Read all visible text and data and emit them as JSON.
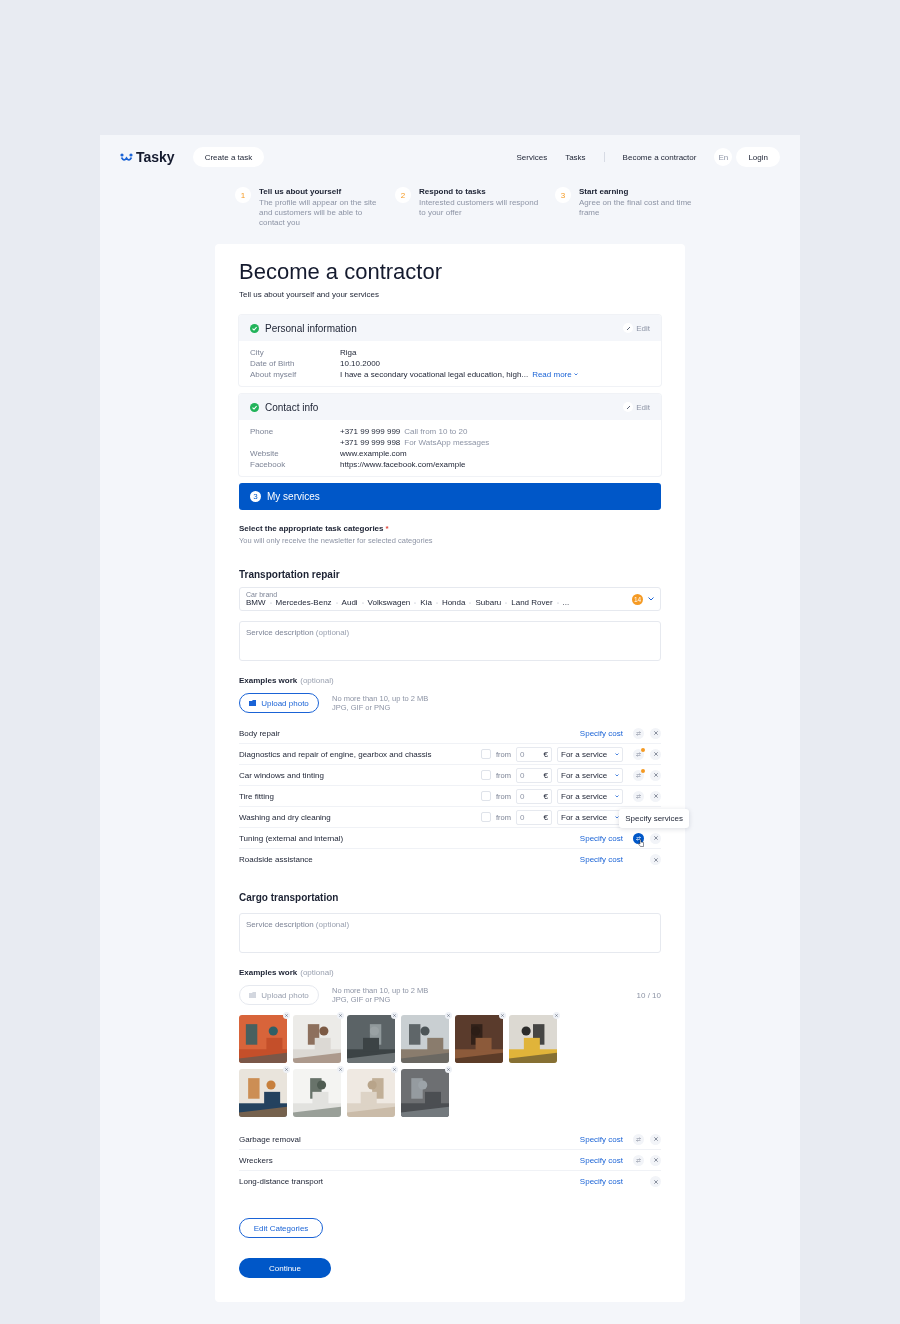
{
  "header": {
    "logo": "Tasky",
    "create_button": "Create a task",
    "nav": [
      "Services",
      "Tasks"
    ],
    "contractor_link": "Become a contractor",
    "language": "En",
    "login": "Login"
  },
  "steps": [
    {
      "number": "1",
      "title": "Tell us about yourself",
      "text": "The profile will appear on the site and customers will be able to contact you"
    },
    {
      "number": "2",
      "title": "Respond to tasks",
      "text": "Interested customers will respond to your offer"
    },
    {
      "number": "3",
      "title": "Start earning",
      "text": "Agree on the final cost and time frame"
    }
  ],
  "page": {
    "title": "Become a contractor",
    "subtitle": "Tell us about yourself and your services"
  },
  "sections": [
    {
      "kind": "completed",
      "title": "Personal information",
      "edit": "Edit",
      "rows": [
        {
          "label": "City",
          "value": "Riga"
        },
        {
          "label": "Date of Birth",
          "value": "10.10.2000"
        },
        {
          "label": "About myself",
          "value": "I have a secondary vocational legal education, high...",
          "link": "Read more"
        }
      ]
    },
    {
      "kind": "completed",
      "title": "Contact info",
      "edit": "Edit",
      "rows": [
        {
          "label": "Phone",
          "value": "+371 99 999 999",
          "note": "Call from 10 to 20"
        },
        {
          "value": "+371 99 999 998",
          "note": "For WatsApp messages"
        },
        {
          "label": "Website",
          "value": "www.example.com"
        },
        {
          "label": "Facebook",
          "value": "https://www.facebook.com/example"
        }
      ]
    },
    {
      "kind": "current",
      "number": "3",
      "title": "My services"
    }
  ],
  "categories": {
    "label": "Select the appropriate task categories",
    "required_mark": "*",
    "hint": "You will only receive the newsletter for selected categories"
  },
  "groups": [
    {
      "title": "Transportation repair",
      "brand_field": {
        "label": "Car brand",
        "values": [
          "BMW",
          "Mercedes-Benz",
          "Audi",
          "Volkswagen",
          "Kia",
          "Honda",
          "Subaru",
          "Land Rover",
          "..."
        ],
        "count": "14"
      },
      "description": {
        "placeholder": "Service description",
        "optional": "(optional)"
      },
      "examples": {
        "label": "Examples work",
        "optional": "(optional)",
        "upload": "Upload photo",
        "upload_disabled": false,
        "rules": [
          "No more than 10, up to 2 MB",
          "JPG, GIF or PNG"
        ]
      },
      "services": [
        {
          "name": "Body repair",
          "kind": "cost",
          "link": "Specify cost",
          "swap": true,
          "swap_badge": false,
          "swap_active": false,
          "removable": true
        },
        {
          "name": "Diagnostics and repair of engine, gearbox and chassis",
          "kind": "price",
          "checked": false,
          "from": "from",
          "amount": "0",
          "currency": "€",
          "unit": "For a service",
          "swap": true,
          "swap_badge": true,
          "swap_active": false,
          "removable": true
        },
        {
          "name": "Car windows and tinting",
          "kind": "price",
          "checked": false,
          "from": "from",
          "amount": "0",
          "currency": "€",
          "unit": "For a service",
          "swap": true,
          "swap_badge": true,
          "swap_active": false,
          "removable": true
        },
        {
          "name": "Tire fitting",
          "kind": "price",
          "checked": false,
          "from": "from",
          "amount": "0",
          "currency": "€",
          "unit": "For a service",
          "swap": true,
          "swap_badge": false,
          "swap_active": false,
          "removable": true
        },
        {
          "name": "Washing and dry cleaning",
          "kind": "price",
          "checked": false,
          "from": "from",
          "amount": "0",
          "currency": "€",
          "unit": "For a service",
          "swap": false,
          "removable": false,
          "tooltip": "Specify services"
        },
        {
          "name": "Tuning (external and internal)",
          "kind": "cost",
          "link": "Specify cost",
          "swap": true,
          "swap_badge": false,
          "swap_active": true,
          "removable": true
        },
        {
          "name": "Roadside assistance",
          "kind": "cost",
          "link": "Specify cost",
          "swap": false,
          "removable": true
        }
      ]
    },
    {
      "title": "Cargo transportation",
      "description": {
        "placeholder": "Service description",
        "optional": "(optional)"
      },
      "examples": {
        "label": "Examples work",
        "optional": "(optional)",
        "upload": "Upload photo",
        "upload_disabled": true,
        "rules": [
          "No more than 10, up to 2 MB",
          "JPG, GIF or PNG"
        ],
        "counter": "10 / 10",
        "photos": [
          {
            "kind": "picture"
          },
          {
            "kind": "picture"
          },
          {
            "kind": "picture"
          },
          {
            "kind": "picture"
          },
          {
            "kind": "picture"
          },
          {
            "kind": "picture"
          },
          {
            "kind": "picture"
          },
          {
            "kind": "picture"
          },
          {
            "kind": "picture"
          },
          {
            "kind": "picture"
          }
        ]
      },
      "services": [
        {
          "name": "Garbage removal",
          "kind": "cost",
          "link": "Specify cost",
          "swap": true,
          "swap_badge": false,
          "swap_active": false,
          "removable": true
        },
        {
          "name": "Wreckers",
          "kind": "cost",
          "link": "Specify cost",
          "swap": true,
          "swap_badge": false,
          "swap_active": false,
          "removable": true
        },
        {
          "name": "Long-distance transport",
          "kind": "cost",
          "link": "Specify cost",
          "swap": false,
          "removable": true
        }
      ]
    }
  ],
  "edit_categories": "Edit Categories",
  "continue": "Continue"
}
